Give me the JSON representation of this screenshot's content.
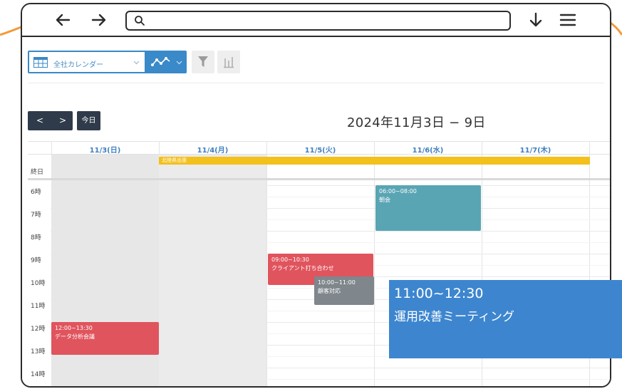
{
  "colors": {
    "frame": "#2b2b2b",
    "accent": "#3a89c9",
    "orange_swoosh": "#f39a3b",
    "nav_dark": "#2f3b4a",
    "weekend_shade": "#e7e7e7"
  },
  "browser": {
    "back_icon": "arrow-left-icon",
    "forward_icon": "arrow-right-icon",
    "search_icon": "search-icon",
    "url_value": "",
    "download_icon": "download-icon",
    "menu_icon": "hamburger-menu-icon"
  },
  "toolbar": {
    "calendar_select": "全社カレンダー",
    "calendar_icon": "calendar-grid-icon",
    "view_icon": "timeline-view-icon",
    "filter_icon": "filter-icon",
    "chart_icon": "bar-chart-icon"
  },
  "nav": {
    "prev": "<",
    "next": ">",
    "today": "今日",
    "range_title": "2024年11月3日 − 9日"
  },
  "calendar": {
    "days": [
      "11/3(日)",
      "11/4(月)",
      "11/5(火)",
      "11/6(水)",
      "11/7(木)"
    ],
    "allday_label": "終日",
    "hours": [
      "6時",
      "7時",
      "8時",
      "9時",
      "10時",
      "11時",
      "12時",
      "13時",
      "14時"
    ],
    "allday_event": "北陸県出張",
    "events": [
      {
        "time": "06:00~08:00",
        "name": "朝会",
        "color": "#5aa5b4"
      },
      {
        "time": "09:00~10:30",
        "name": "クライアント打ち合わせ",
        "color": "#e0545e"
      },
      {
        "time": "10:00~11:00",
        "name": "顧客対応",
        "color": "#7f868c"
      },
      {
        "time": "12:00~13:30",
        "name": "データ分析会議",
        "color": "#e0545e"
      }
    ]
  },
  "popup": {
    "time": "11:00~12:30",
    "name": "運用改善ミーティング",
    "color": "#3d86cf"
  }
}
